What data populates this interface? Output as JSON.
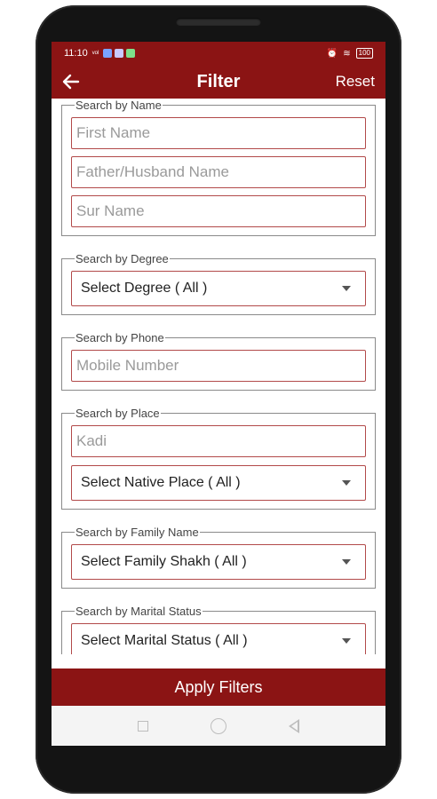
{
  "status_bar": {
    "time": "11:10",
    "signal": "ᵛᵒˡ",
    "battery": "100"
  },
  "app_bar": {
    "title": "Filter",
    "reset_label": "Reset"
  },
  "groups": {
    "name": {
      "legend": "Search by Name",
      "first_name_placeholder": "First Name",
      "father_husband_placeholder": "Father/Husband Name",
      "surname_placeholder": "Sur Name"
    },
    "degree": {
      "legend": "Search by Degree",
      "select_value": "Select Degree ( All )"
    },
    "phone": {
      "legend": "Search by Phone",
      "mobile_placeholder": "Mobile Number"
    },
    "place": {
      "legend": "Search by Place",
      "place_placeholder": "Kadi",
      "native_place_value": "Select Native Place ( All )"
    },
    "family": {
      "legend": "Search by Family Name",
      "select_value": "Select Family Shakh ( All )"
    },
    "marital": {
      "legend": "Search by Marital Status",
      "select_value": "Select Marital Status ( All )"
    }
  },
  "apply_label": "Apply Filters",
  "colors": {
    "primary": "#8b1414",
    "input_border": "#b24a4a"
  },
  "icons": [
    "back-arrow-icon",
    "dropdown-caret-icon",
    "nav-recents-icon",
    "nav-home-icon",
    "nav-back-icon"
  ]
}
